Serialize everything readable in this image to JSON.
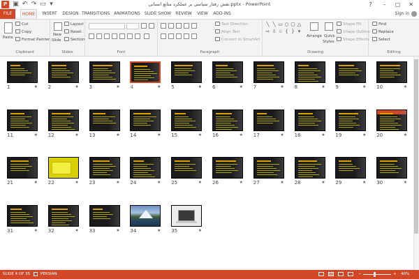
{
  "title_bar": {
    "app_icon": "P",
    "title": "نقش رفتار سیاسی بر عملکرد منابع انسانی.pptx - PowerPoint",
    "help": "?",
    "minimize": "–",
    "restore": "▢",
    "close": "✕"
  },
  "tabs": [
    "FILE",
    "HOME",
    "INSERT",
    "DESIGN",
    "TRANSITIONS",
    "ANIMATIONS",
    "SLIDE SHOW",
    "REVIEW",
    "VIEW",
    "ADD-INS"
  ],
  "active_tab": "HOME",
  "sign_in": "Sign in",
  "ribbon": {
    "clipboard": {
      "paste": "Paste",
      "cut": "Cut",
      "copy": "Copy",
      "format_painter": "Format Painter",
      "label": "Clipboard"
    },
    "slides": {
      "new_slide": "New",
      "new_slide_2": "Slide",
      "layout": "Layout",
      "reset": "Reset",
      "section": "Section",
      "label": "Slides"
    },
    "font": {
      "label": "Font"
    },
    "paragraph": {
      "text_direction": "Text Direction",
      "align_text": "Align Text",
      "convert": "Convert to SmartArt",
      "label": "Paragraph"
    },
    "drawing": {
      "arrange": "Arrange",
      "quick_styles": "Quick",
      "quick_styles_2": "Styles",
      "shape_fill": "Shape Fill",
      "shape_outline": "Shape Outline",
      "shape_effects": "Shape Effects",
      "label": "Drawing"
    },
    "editing": {
      "find": "Find",
      "replace": "Replace",
      "select": "Select",
      "label": "Editing"
    }
  },
  "slides": [
    "1",
    "2",
    "3",
    "4",
    "5",
    "6",
    "7",
    "8",
    "9",
    "10",
    "11",
    "12",
    "13",
    "14",
    "15",
    "16",
    "17",
    "18",
    "19",
    "20",
    "21",
    "22",
    "23",
    "24",
    "25",
    "26",
    "27",
    "28",
    "29",
    "30",
    "31",
    "32",
    "33",
    "34",
    "35"
  ],
  "selected_slide": "4",
  "star_glyph": "★",
  "status": {
    "slide_info": "SLIDE 4 OF 35",
    "language": "PERSIAN",
    "zoom": "40%"
  },
  "colors": {
    "accent": "#d24726",
    "slide_bg": "#1b1b1b",
    "slide_text": "#c8c000"
  }
}
